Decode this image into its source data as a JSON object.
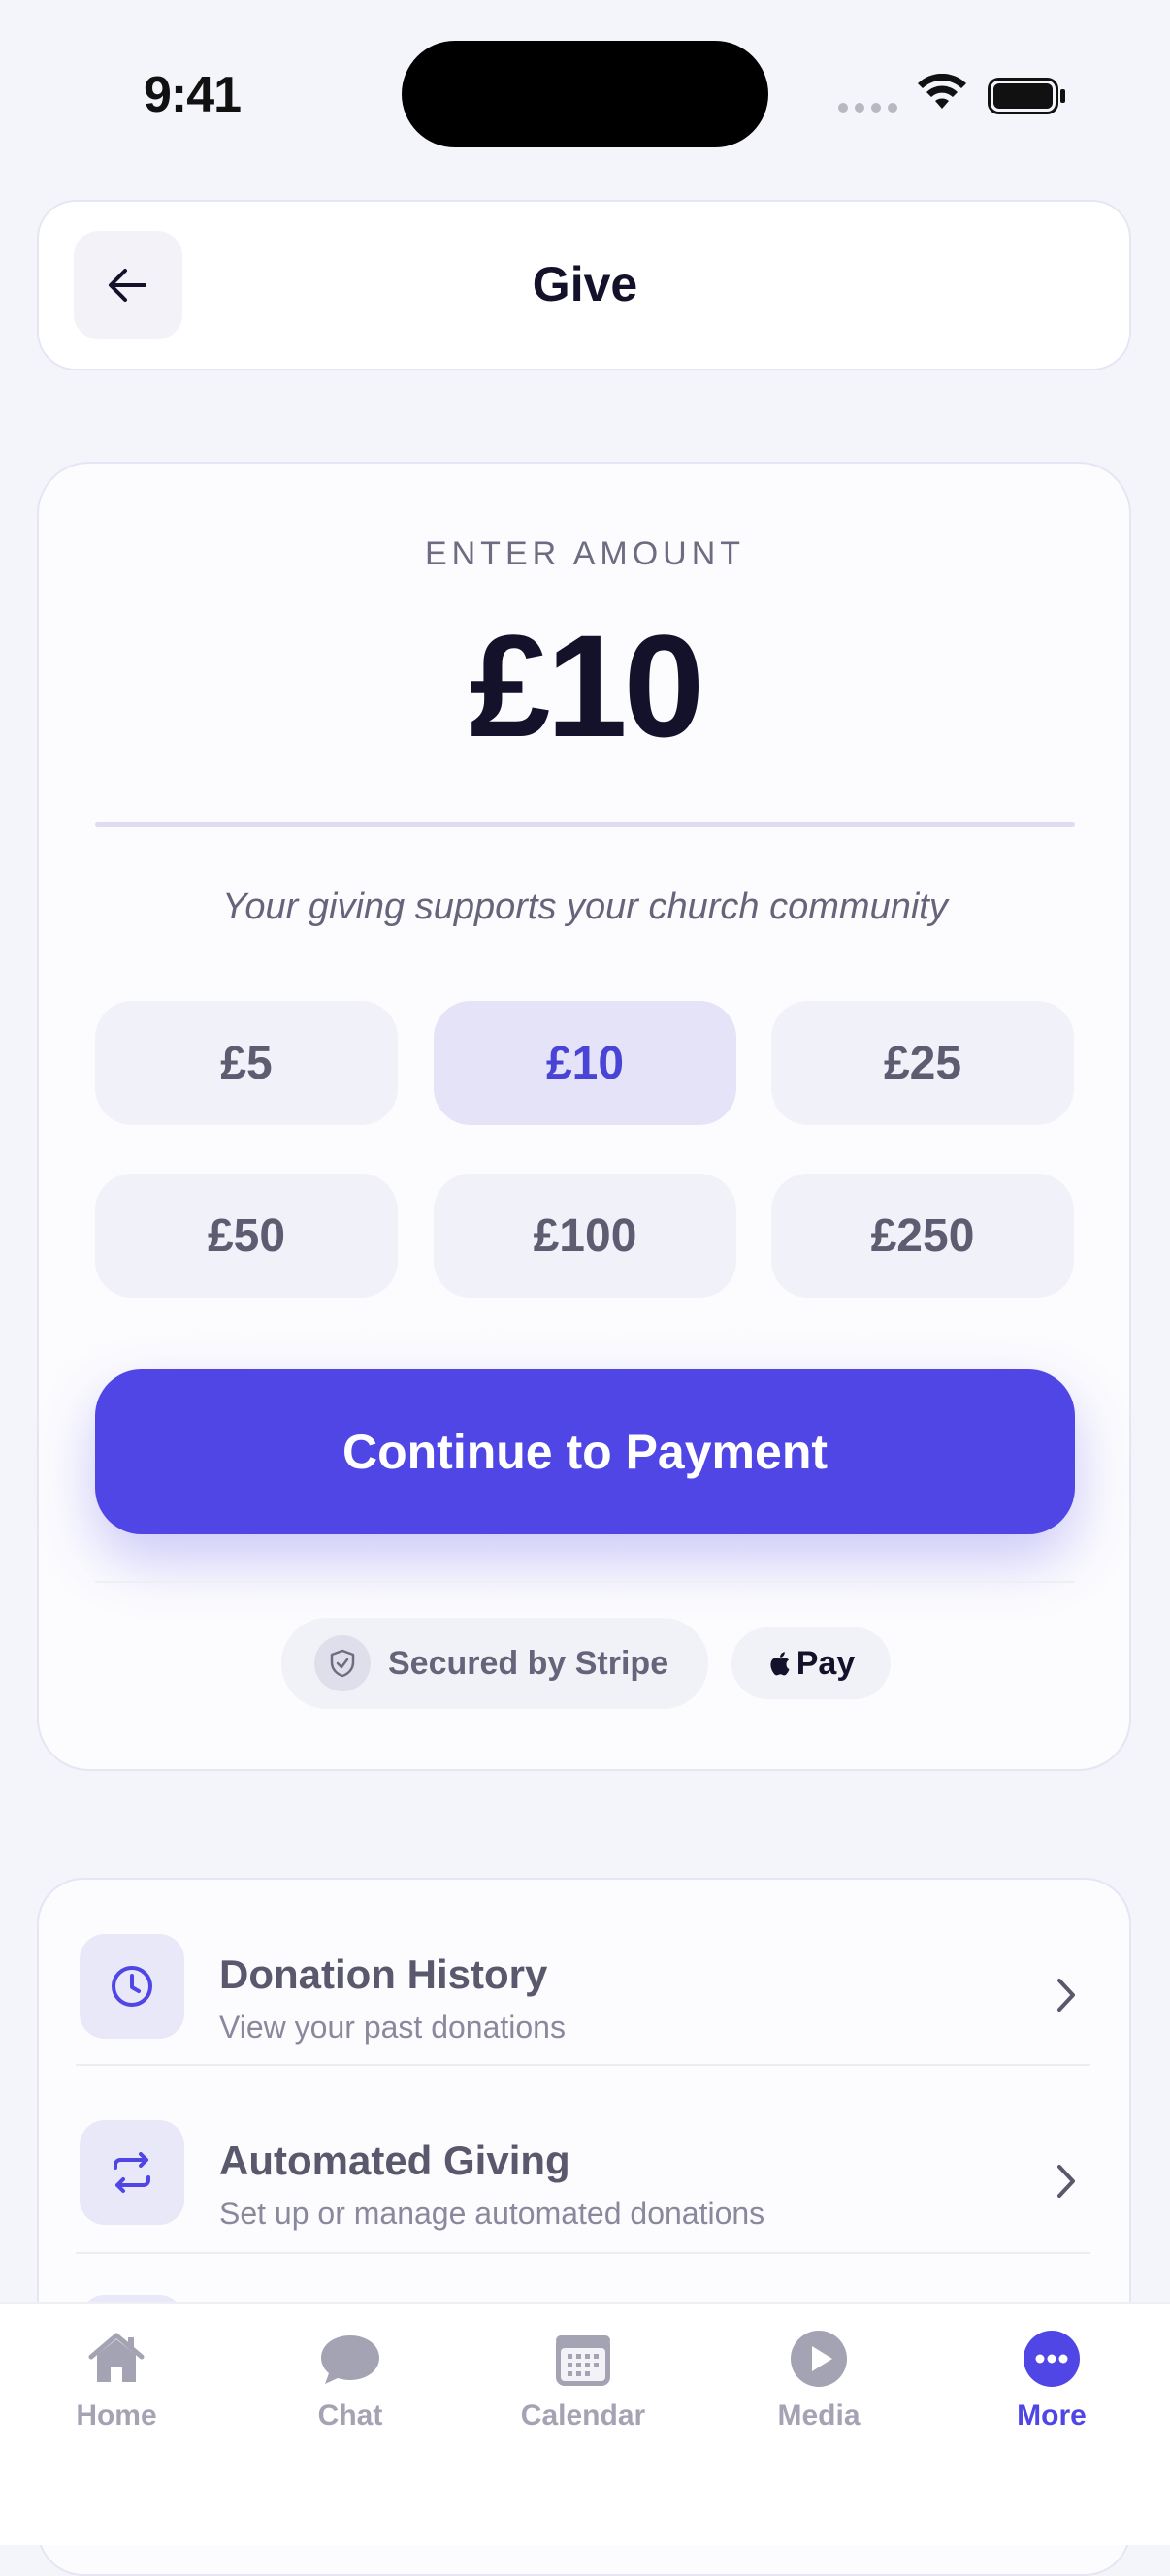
{
  "status_bar": {
    "time": "9:41"
  },
  "header": {
    "title": "Give"
  },
  "amount_entry": {
    "label": "ENTER AMOUNT",
    "value": "£10",
    "support_text": "Your giving supports your church community",
    "presets": [
      "£5",
      "£10",
      "£25",
      "£50",
      "£100",
      "£250"
    ],
    "selected_preset": "£10"
  },
  "payment": {
    "continue_label": "Continue to Payment",
    "secured_label": "Secured by Stripe",
    "apple_pay_label": "Pay"
  },
  "menu": {
    "items": [
      {
        "title": "Donation History",
        "subtitle": "View your past donations",
        "icon": "clock-icon"
      },
      {
        "title": "Automated Giving",
        "subtitle": "Set up or manage automated donations",
        "icon": "repeat-icon"
      }
    ]
  },
  "tabbar": {
    "tabs": [
      {
        "label": "Home",
        "icon": "home-icon"
      },
      {
        "label": "Chat",
        "icon": "chat-icon"
      },
      {
        "label": "Calendar",
        "icon": "calendar-icon"
      },
      {
        "label": "Media",
        "icon": "play-icon"
      },
      {
        "label": "More",
        "icon": "more-icon"
      }
    ],
    "active": "More"
  },
  "colors": {
    "accent": "#4f46e5",
    "background": "#f4f4fb",
    "text": "#14122b"
  }
}
